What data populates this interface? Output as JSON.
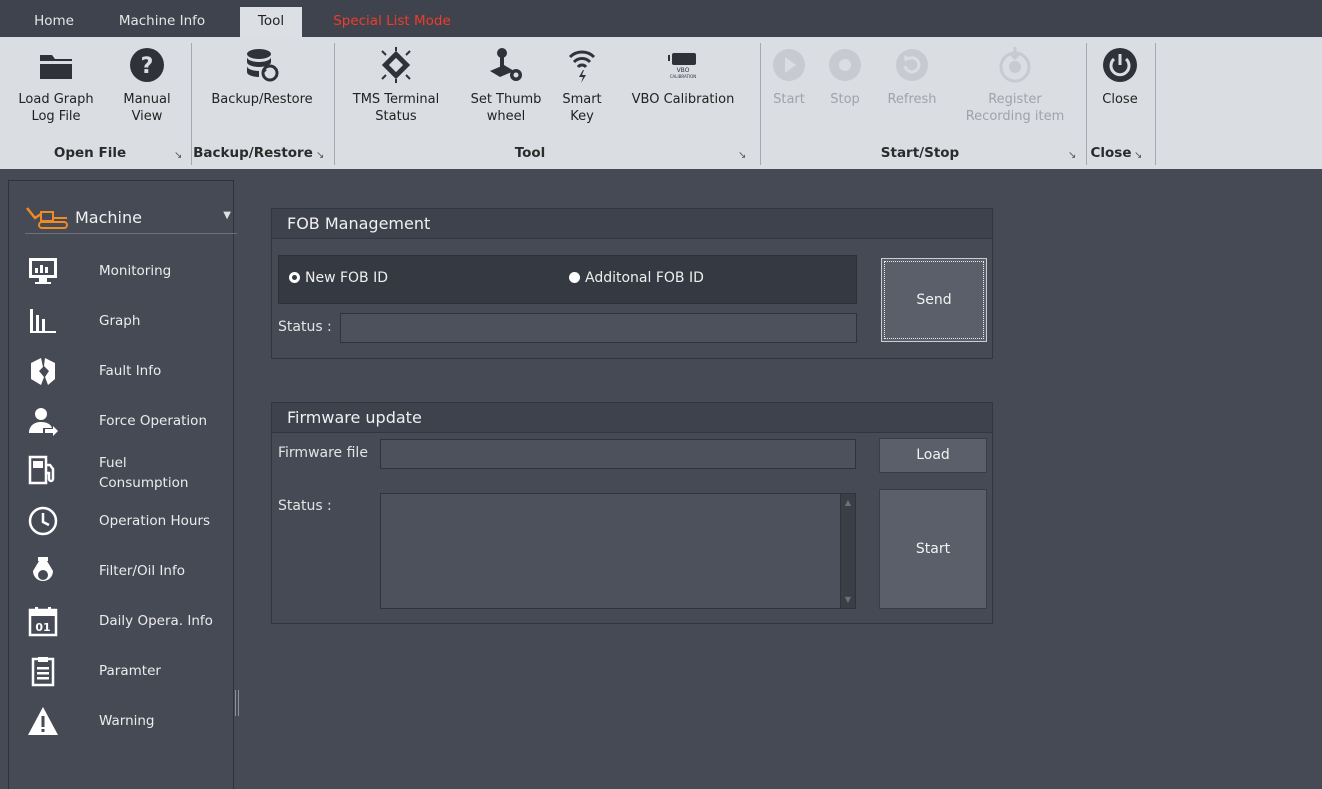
{
  "tabs": {
    "home": "Home",
    "machine_info": "Machine Info",
    "tool": "Tool",
    "special": "Special List Mode"
  },
  "ribbon": {
    "load_graph": "Load Graph\nLog File",
    "manual_view": "Manual\nView",
    "backup_restore": "Backup/Restore",
    "tms_status": "TMS Terminal\nStatus",
    "set_thumb": "Set Thumb\nwheel",
    "smart_key": "Smart\nKey",
    "vbo_cal": "VBO Calibration",
    "vbo_icon_text1": "VBO",
    "vbo_icon_text2": "CALIBRATION",
    "start": "Start",
    "stop": "Stop",
    "refresh": "Refresh",
    "register": "Register\nRecording item",
    "close": "Close",
    "groups": {
      "open_file": "Open File",
      "backup_restore": "Backup/Restore",
      "tool": "Tool",
      "start_stop": "Start/Stop",
      "close": "Close"
    }
  },
  "sidebar": {
    "header": "Machine",
    "items": [
      {
        "label": "Monitoring",
        "icon": "monitor-chart-icon"
      },
      {
        "label": "Graph",
        "icon": "bar-chart-icon"
      },
      {
        "label": "Fault Info",
        "icon": "broken-shield-icon"
      },
      {
        "label": "Force Operation",
        "icon": "user-arrow-icon"
      },
      {
        "label": "Fuel\nConsumption",
        "icon": "fuel-pump-icon"
      },
      {
        "label": "Operation Hours",
        "icon": "clock-icon"
      },
      {
        "label": "Filter/Oil Info",
        "icon": "oil-drop-icon"
      },
      {
        "label": "Daily Opera. Info",
        "icon": "calendar-icon"
      },
      {
        "label": "Paramter",
        "icon": "clipboard-list-icon"
      },
      {
        "label": "Warning",
        "icon": "warning-triangle-icon"
      }
    ],
    "calendar_day": "01"
  },
  "fob": {
    "title": "FOB Management",
    "option_new": "New FOB ID",
    "option_additional": "Additonal FOB ID",
    "selected": "new",
    "status_label": "Status :",
    "status_value": "",
    "send": "Send"
  },
  "firmware": {
    "title": "Firmware update",
    "file_label": "Firmware file",
    "file_value": "",
    "load": "Load",
    "status_label": "Status :",
    "status_value": "",
    "start": "Start"
  },
  "colors": {
    "background": "#454a55",
    "ribbon": "#dadde2",
    "special_tab": "#f03c28",
    "machine_icon": "#f08a24"
  }
}
